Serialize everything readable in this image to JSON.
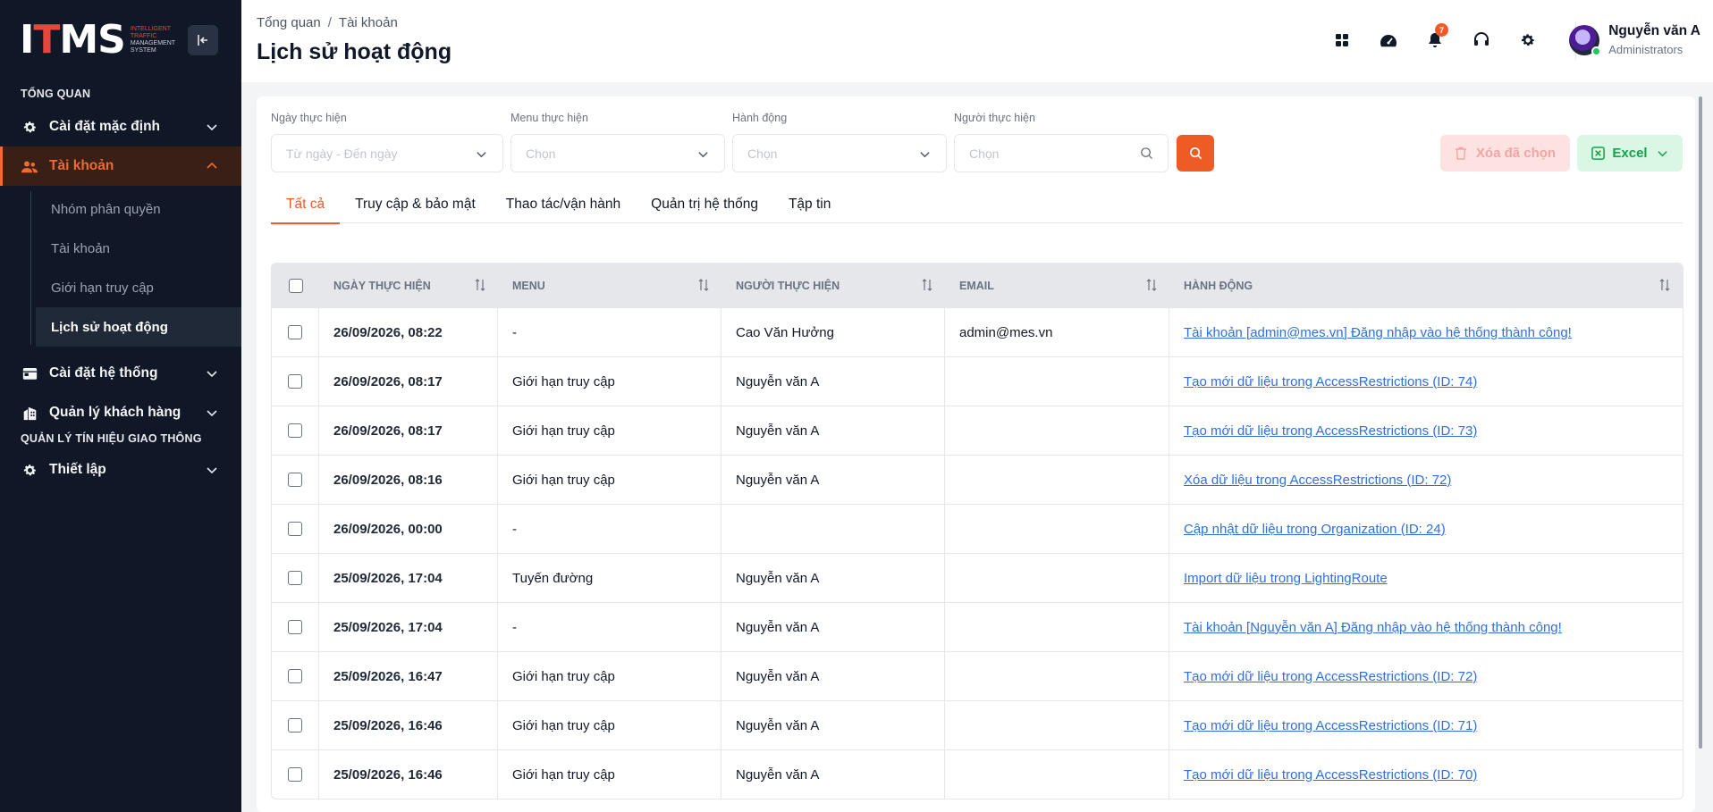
{
  "sidebar": {
    "logo_main": "ITMS",
    "logo_sub_1": "INTELLIGENT",
    "logo_sub_2": "TRAFFIC",
    "logo_sub_3": "MANAGEMENT",
    "logo_sub_4": "SYSTEM",
    "section_overview": "TỔNG QUAN",
    "items": [
      {
        "label": "Cài đặt mặc định"
      },
      {
        "label": "Tài khoản"
      },
      {
        "label": "Cài đặt hệ thống"
      },
      {
        "label": "Quản lý khách hàng"
      }
    ],
    "subitems": [
      {
        "label": "Nhóm phân quyền"
      },
      {
        "label": "Tài khoản"
      },
      {
        "label": "Giới hạn truy cập"
      },
      {
        "label": "Lịch sử hoạt động"
      }
    ],
    "section_traffic": "QUẢN LÝ TÍN HIỆU GIAO THÔNG",
    "setup_label": "Thiết lập"
  },
  "header": {
    "breadcrumb": [
      "Tổng quan",
      "/",
      "Tài khoản"
    ],
    "title": "Lịch sử hoạt động",
    "notification_count": "7",
    "user_name": "Nguyễn văn A",
    "user_role": "Administrators"
  },
  "filters": {
    "date_label": "Ngày thực hiện",
    "date_placeholder": "Từ ngày - Đến ngày",
    "menu_label": "Menu thực hiện",
    "menu_placeholder": "Chọn",
    "action_label": "Hành động",
    "action_placeholder": "Chọn",
    "user_label": "Người thực hiện",
    "user_placeholder": "Chọn",
    "delete_label": "Xóa đã chọn",
    "excel_label": "Excel"
  },
  "tabs": [
    {
      "label": "Tất cả"
    },
    {
      "label": "Truy cập & bảo mật"
    },
    {
      "label": "Thao tác/vận hành"
    },
    {
      "label": "Quản trị hệ thống"
    },
    {
      "label": "Tập tin"
    }
  ],
  "table": {
    "columns": [
      "Ngày thực hiện",
      "Menu",
      "Người thực hiện",
      "Email",
      "Hành động"
    ],
    "rows": [
      {
        "date": "26/09/2026, 08:22",
        "menu": "-",
        "user": "Cao Văn Hưởng",
        "email": "admin@mes.vn",
        "action": "Tài khoản [admin@mes.vn] Đăng nhập vào hệ thống thành công!"
      },
      {
        "date": "26/09/2026, 08:17",
        "menu": "Giới hạn truy cập",
        "user": "Nguyễn văn A",
        "email": "",
        "action": "Tạo mới dữ liệu trong AccessRestrictions (ID: 74)"
      },
      {
        "date": "26/09/2026, 08:17",
        "menu": "Giới hạn truy cập",
        "user": "Nguyễn văn A",
        "email": "",
        "action": "Tạo mới dữ liệu trong AccessRestrictions (ID: 73)"
      },
      {
        "date": "26/09/2026, 08:16",
        "menu": "Giới hạn truy cập",
        "user": "Nguyễn văn A",
        "email": "",
        "action": "Xóa dữ liệu trong AccessRestrictions (ID: 72)"
      },
      {
        "date": "26/09/2026, 00:00",
        "menu": "-",
        "user": "",
        "email": "",
        "action": "Cập nhật dữ liệu trong Organization (ID: 24)"
      },
      {
        "date": "25/09/2026, 17:04",
        "menu": "Tuyến đường",
        "user": "Nguyễn văn A",
        "email": "",
        "action": "Import dữ liệu trong LightingRoute"
      },
      {
        "date": "25/09/2026, 17:04",
        "menu": "-",
        "user": "Nguyễn văn A",
        "email": "",
        "action": "Tài khoản [Nguyễn văn A] Đăng nhập vào hệ thống thành công!"
      },
      {
        "date": "25/09/2026, 16:47",
        "menu": "Giới hạn truy cập",
        "user": "Nguyễn văn A",
        "email": "",
        "action": "Tạo mới dữ liệu trong AccessRestrictions (ID: 72)"
      },
      {
        "date": "25/09/2026, 16:46",
        "menu": "Giới hạn truy cập",
        "user": "Nguyễn văn A",
        "email": "",
        "action": "Tạo mới dữ liệu trong AccessRestrictions (ID: 71)"
      },
      {
        "date": "25/09/2026, 16:46",
        "menu": "Giới hạn truy cập",
        "user": "Nguyễn văn A",
        "email": "",
        "action": "Tạo mới dữ liệu trong AccessRestrictions (ID: 70)"
      }
    ]
  },
  "colors": {
    "accent": "#ef5b25",
    "sidebar_bg": "#101828",
    "link": "#2f6fdf",
    "excel": "#16a34a"
  }
}
